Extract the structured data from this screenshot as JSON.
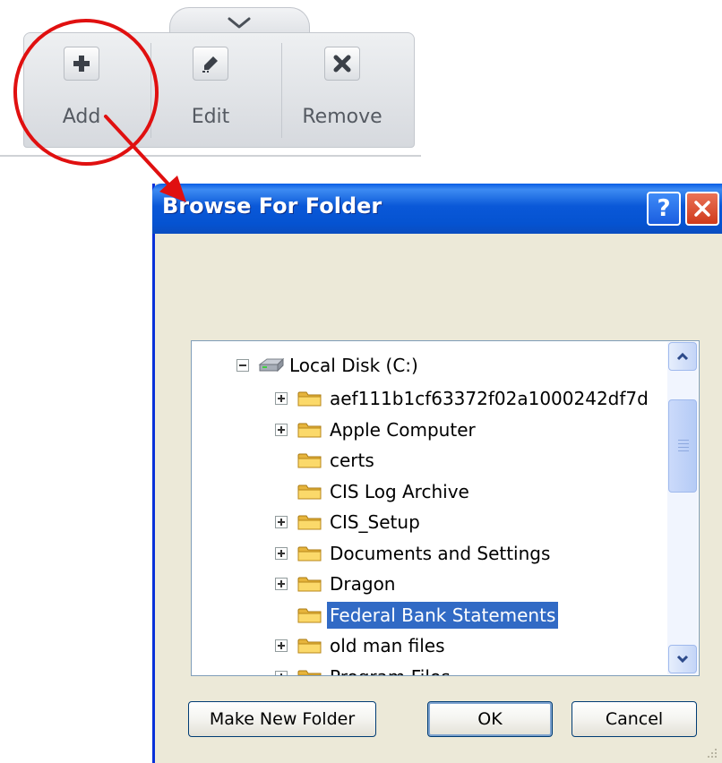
{
  "toolbar": {
    "buttons": [
      {
        "label": "Add",
        "icon": "plus-icon"
      },
      {
        "label": "Edit",
        "icon": "pencil-icon"
      },
      {
        "label": "Remove",
        "icon": "x-icon"
      }
    ],
    "collapse_icon": "chevron-down-icon"
  },
  "annotation": {
    "color": "#e01010"
  },
  "dialog": {
    "title": "Browse For Folder",
    "help_label": "?",
    "tree": {
      "root": "Local Disk (C:)",
      "items": [
        {
          "label": "aef111b1cf63372f02a1000242df7d",
          "expandable": true,
          "selected": false
        },
        {
          "label": "Apple Computer",
          "expandable": true,
          "selected": false
        },
        {
          "label": "certs",
          "expandable": false,
          "selected": false
        },
        {
          "label": "CIS Log Archive",
          "expandable": false,
          "selected": false
        },
        {
          "label": "CIS_Setup",
          "expandable": true,
          "selected": false
        },
        {
          "label": "Documents and Settings",
          "expandable": true,
          "selected": false
        },
        {
          "label": "Dragon",
          "expandable": true,
          "selected": false
        },
        {
          "label": "Federal Bank Statements",
          "expandable": false,
          "selected": true
        },
        {
          "label": "old man files",
          "expandable": true,
          "selected": false
        },
        {
          "label": "Program Files",
          "expandable": true,
          "selected": false
        }
      ]
    },
    "buttons": {
      "make_new_folder": "Make New Folder",
      "ok": "OK",
      "cancel": "Cancel"
    },
    "colors": {
      "title_bar": "#0a58d8",
      "selection": "#316ac5",
      "close": "#d8492a"
    }
  }
}
